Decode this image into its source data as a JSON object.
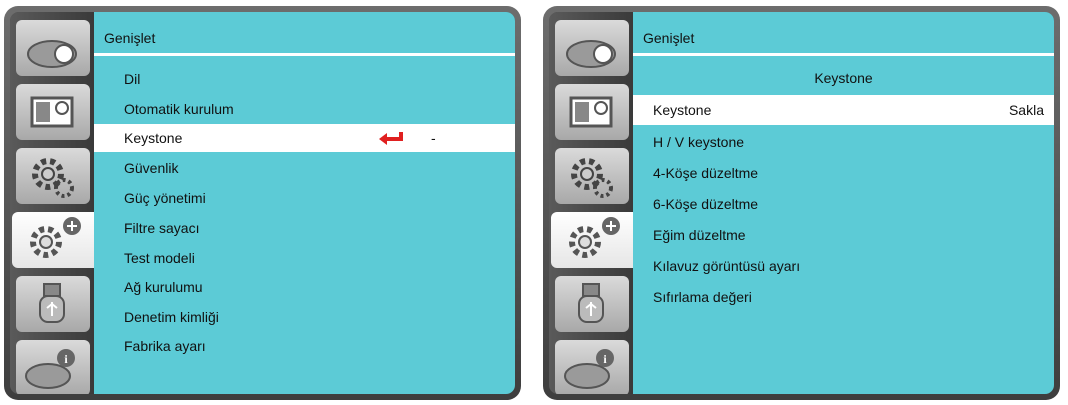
{
  "icons": [
    "projector-icon",
    "image-adjust-icon",
    "settings-gear-icon",
    "expand-settings-icon",
    "usb-icon",
    "info-icon"
  ],
  "left_panel": {
    "title": "Genişlet",
    "items": [
      {
        "label": "Dil"
      },
      {
        "label": "Otomatik kurulum"
      },
      {
        "label": "Keystone",
        "selected": true,
        "value": "-"
      },
      {
        "label": "Güvenlik"
      },
      {
        "label": "Güç yönetimi"
      },
      {
        "label": "Filtre sayacı"
      },
      {
        "label": "Test modeli"
      },
      {
        "label": "Ağ kurulumu"
      },
      {
        "label": "Denetim kimliği"
      },
      {
        "label": "Fabrika ayarı"
      }
    ]
  },
  "right_panel": {
    "title": "Genişlet",
    "subtitle": "Keystone",
    "items": [
      {
        "label": "Keystone",
        "value": "Sakla",
        "selected": true
      },
      {
        "label": "H / V keystone"
      },
      {
        "label": "4-Köşe düzeltme"
      },
      {
        "label": "6-Köşe düzeltme"
      },
      {
        "label": "Eğim düzeltme"
      },
      {
        "label": "Kılavuz görüntüsü ayarı"
      },
      {
        "label": "Sıfırlama değeri"
      }
    ]
  },
  "colors": {
    "menu_bg": "#5ccbd6",
    "selected_bg": "#ffffff",
    "enter_arrow": "#e02020"
  }
}
